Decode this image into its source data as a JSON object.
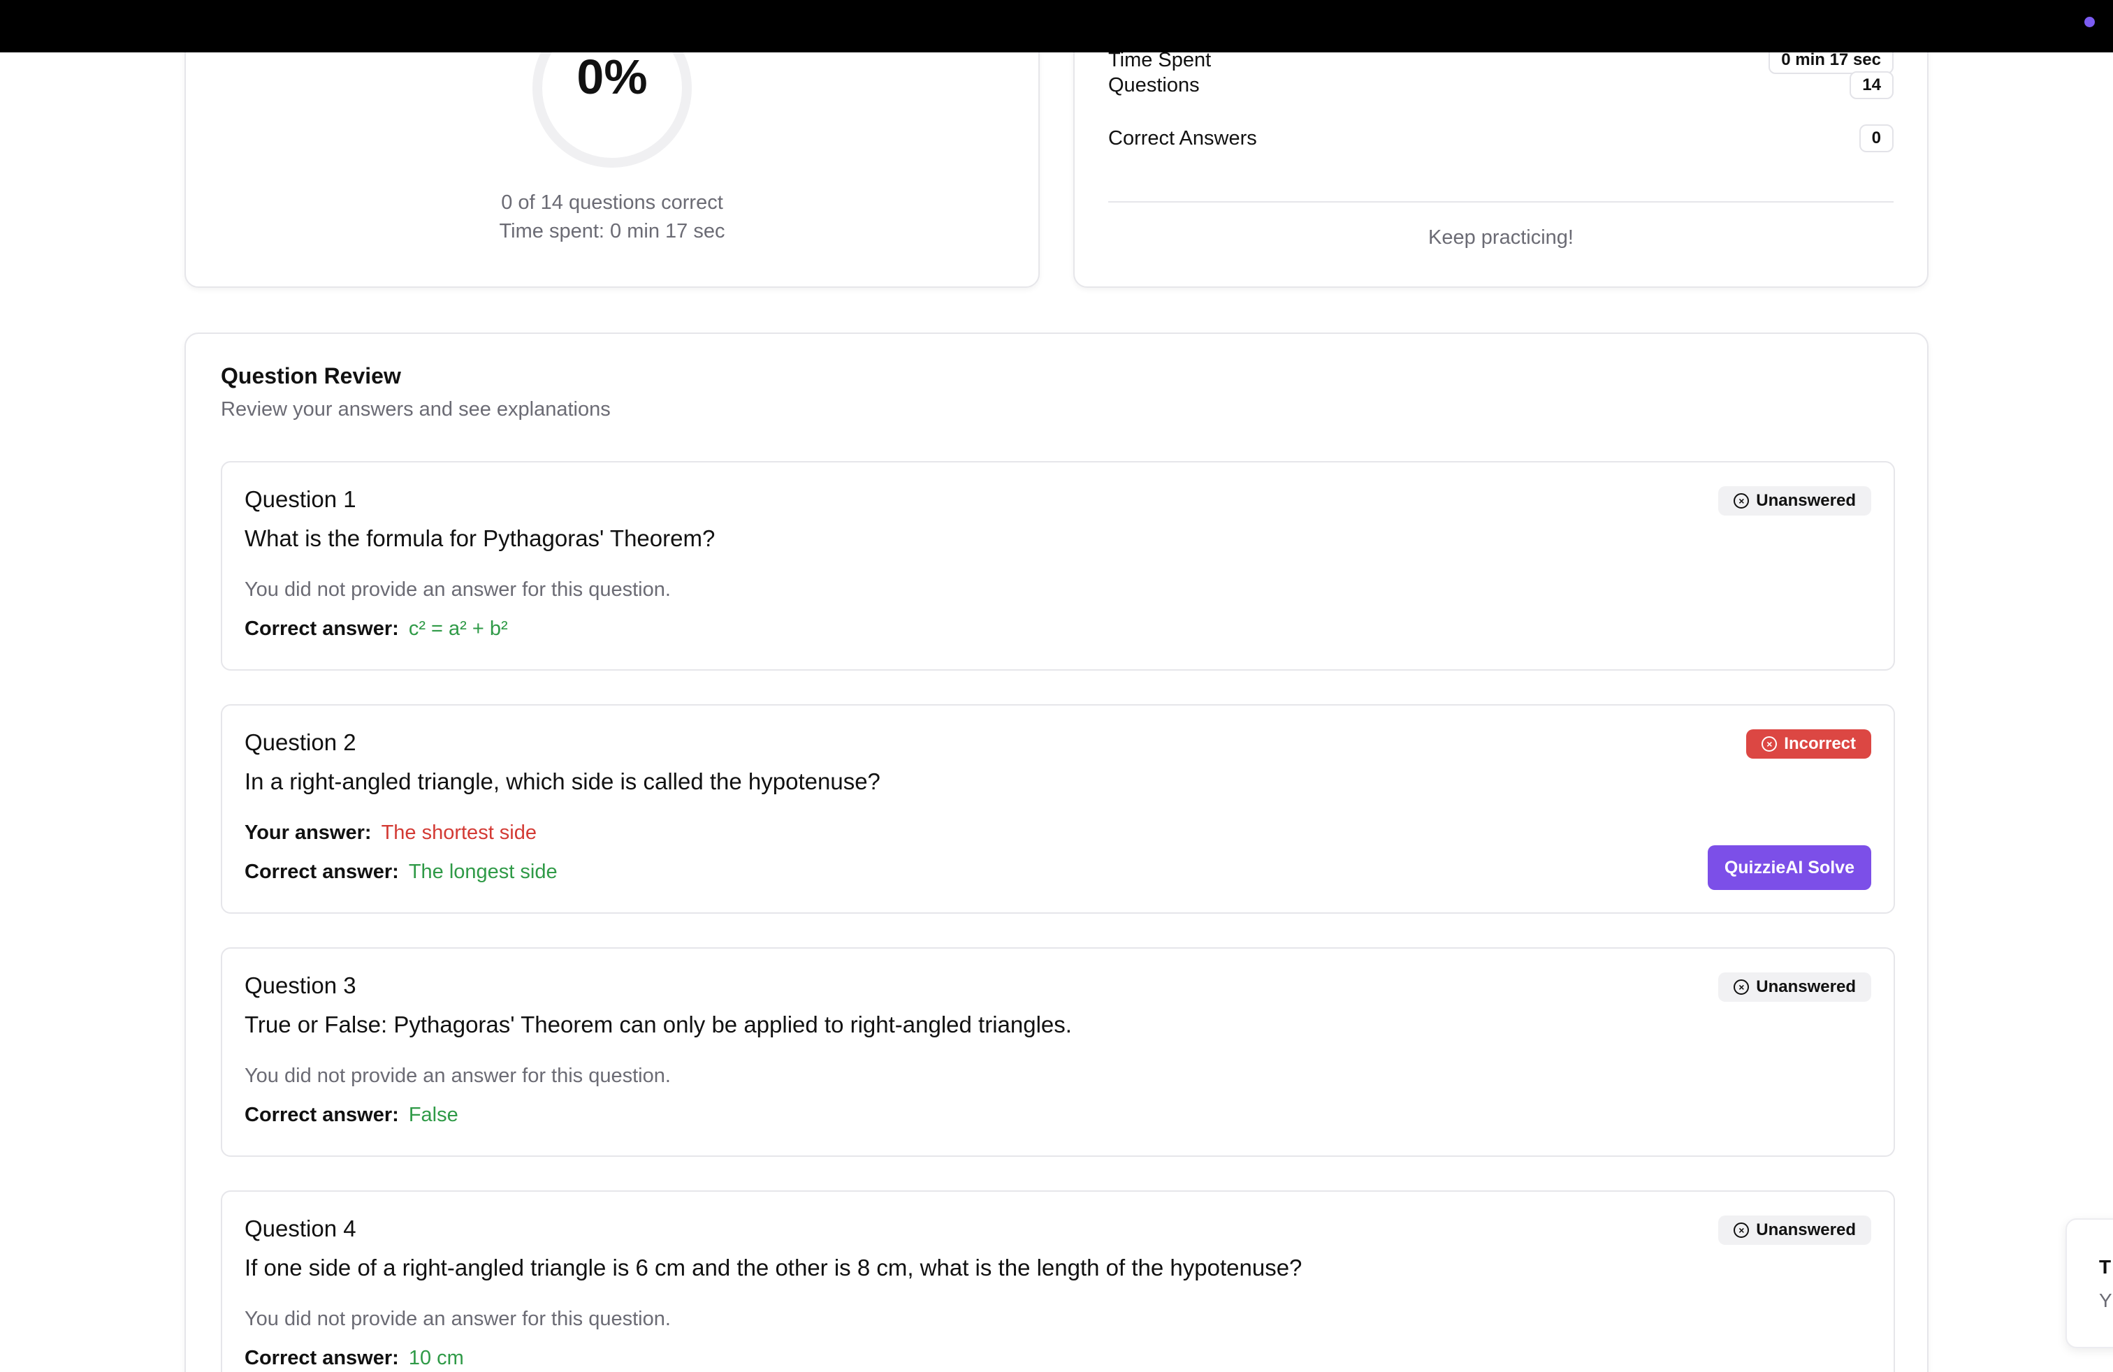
{
  "score": {
    "percent": "0%",
    "correct_line": "0 of 14 questions correct",
    "time_line": "Time spent: 0 min 17 sec",
    "fraction_correct": 0
  },
  "stats": {
    "rows": [
      {
        "label": "Time Spent",
        "value": "0 min 17 sec"
      },
      {
        "label": "Questions",
        "value": "14"
      },
      {
        "label": "Correct Answers",
        "value": "0"
      }
    ],
    "message": "Keep practicing!"
  },
  "review": {
    "title": "Question Review",
    "subtitle": "Review your answers and see explanations",
    "correct_label": "Correct answer:",
    "your_label": "Your answer:",
    "no_answer_text": "You did not provide an answer for this question.",
    "solve_button": "QuizzieAI Solve",
    "questions": [
      {
        "number": "Question 1",
        "text": "What is the formula for Pythagoras' Theorem?",
        "status": "Unanswered",
        "correct": "c² = a² + b²"
      },
      {
        "number": "Question 2",
        "text": "In a right-angled triangle, which side is called the hypotenuse?",
        "status": "Incorrect",
        "your": "The shortest side",
        "correct": "The longest side"
      },
      {
        "number": "Question 3",
        "text": "True or False: Pythagoras' Theorem can only be applied to right-angled triangles.",
        "status": "Unanswered",
        "correct": "False"
      },
      {
        "number": "Question 4",
        "text": "If one side of a right-angled triangle is 6 cm and the other is 8 cm, what is the length of the hypotenuse?",
        "status": "Unanswered",
        "correct": "10 cm"
      }
    ]
  },
  "toast": {
    "line1": "T",
    "line2": "Y"
  },
  "colors": {
    "accent": "#7c4fe8",
    "correct": "#2f9a47",
    "incorrect": "#d33a34",
    "incorrect_badge": "#dc4743"
  }
}
